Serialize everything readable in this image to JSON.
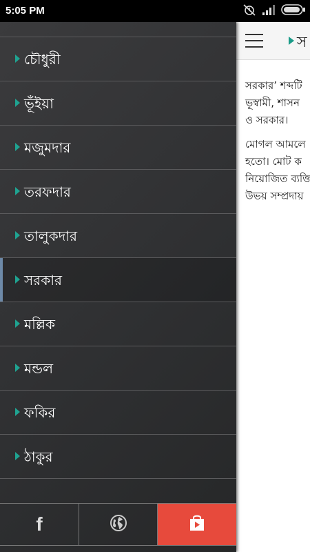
{
  "status_bar": {
    "time": "5:05 PM",
    "icons": [
      "alarm-off-icon",
      "signal-icon",
      "battery-icon"
    ]
  },
  "content": {
    "title_partial": "স",
    "paragraphs": [
      "সরকার’ শব্দটি\nভূস্বামী, শাসন\nও সরকার।",
      "মোগল আমলে\nহতো। মোট ক\nনিয়োজিত ব্যক্তি\nউভয় সম্প্রদায়"
    ]
  },
  "drawer": {
    "items": [
      {
        "label": "চৌধুরী"
      },
      {
        "label": "ভূঁইয়া"
      },
      {
        "label": "মজুমদার"
      },
      {
        "label": "তরফদার"
      },
      {
        "label": "তালুকদার"
      },
      {
        "label": "সরকার"
      },
      {
        "label": "মল্লিক"
      },
      {
        "label": "মন্ডল"
      },
      {
        "label": "ফকির"
      },
      {
        "label": "ঠাকুর"
      }
    ],
    "active_index": 5
  },
  "bottom_bar": {
    "facebook_icon": "facebook-icon",
    "web_icon": "globe-icon",
    "store_icon": "play-store-icon",
    "store_color": "#e74a3c"
  },
  "colors": {
    "accent_arrow": "#1fa391",
    "drawer_bg": "#2f3032",
    "active_indicator": "#6d89a8"
  }
}
